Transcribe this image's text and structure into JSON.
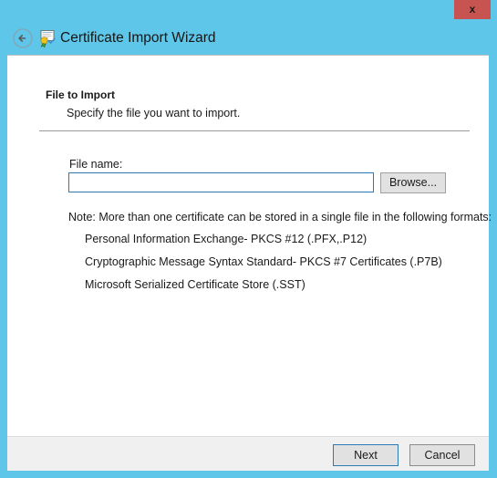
{
  "window": {
    "titlebar_color": "#5ec6e8",
    "title": "Certificate Import Wizard",
    "close_label": "x",
    "back_icon": "back-arrow-icon",
    "app_icon": "certificate-icon"
  },
  "content": {
    "section_title": "File to Import",
    "section_subtitle": "Specify the file you want to import.",
    "file_name_label": "File name:",
    "file_name_value": "",
    "file_name_placeholder": "",
    "browse_label": "Browse...",
    "note_intro": "Note:  More than one certificate can be stored in a single file in the following formats:",
    "formats": [
      "Personal Information Exchange- PKCS #12 (.PFX,.P12)",
      "Cryptographic Message Syntax Standard- PKCS #7 Certificates (.P7B)",
      "Microsoft Serialized Certificate Store (.SST)"
    ]
  },
  "footer": {
    "next_label": "Next",
    "cancel_label": "Cancel"
  },
  "colors": {
    "accent_blue": "#5ec6e8",
    "close_red": "#c75450",
    "focus_border": "#2b7ab5",
    "footer_bg": "#f0f0f0"
  }
}
